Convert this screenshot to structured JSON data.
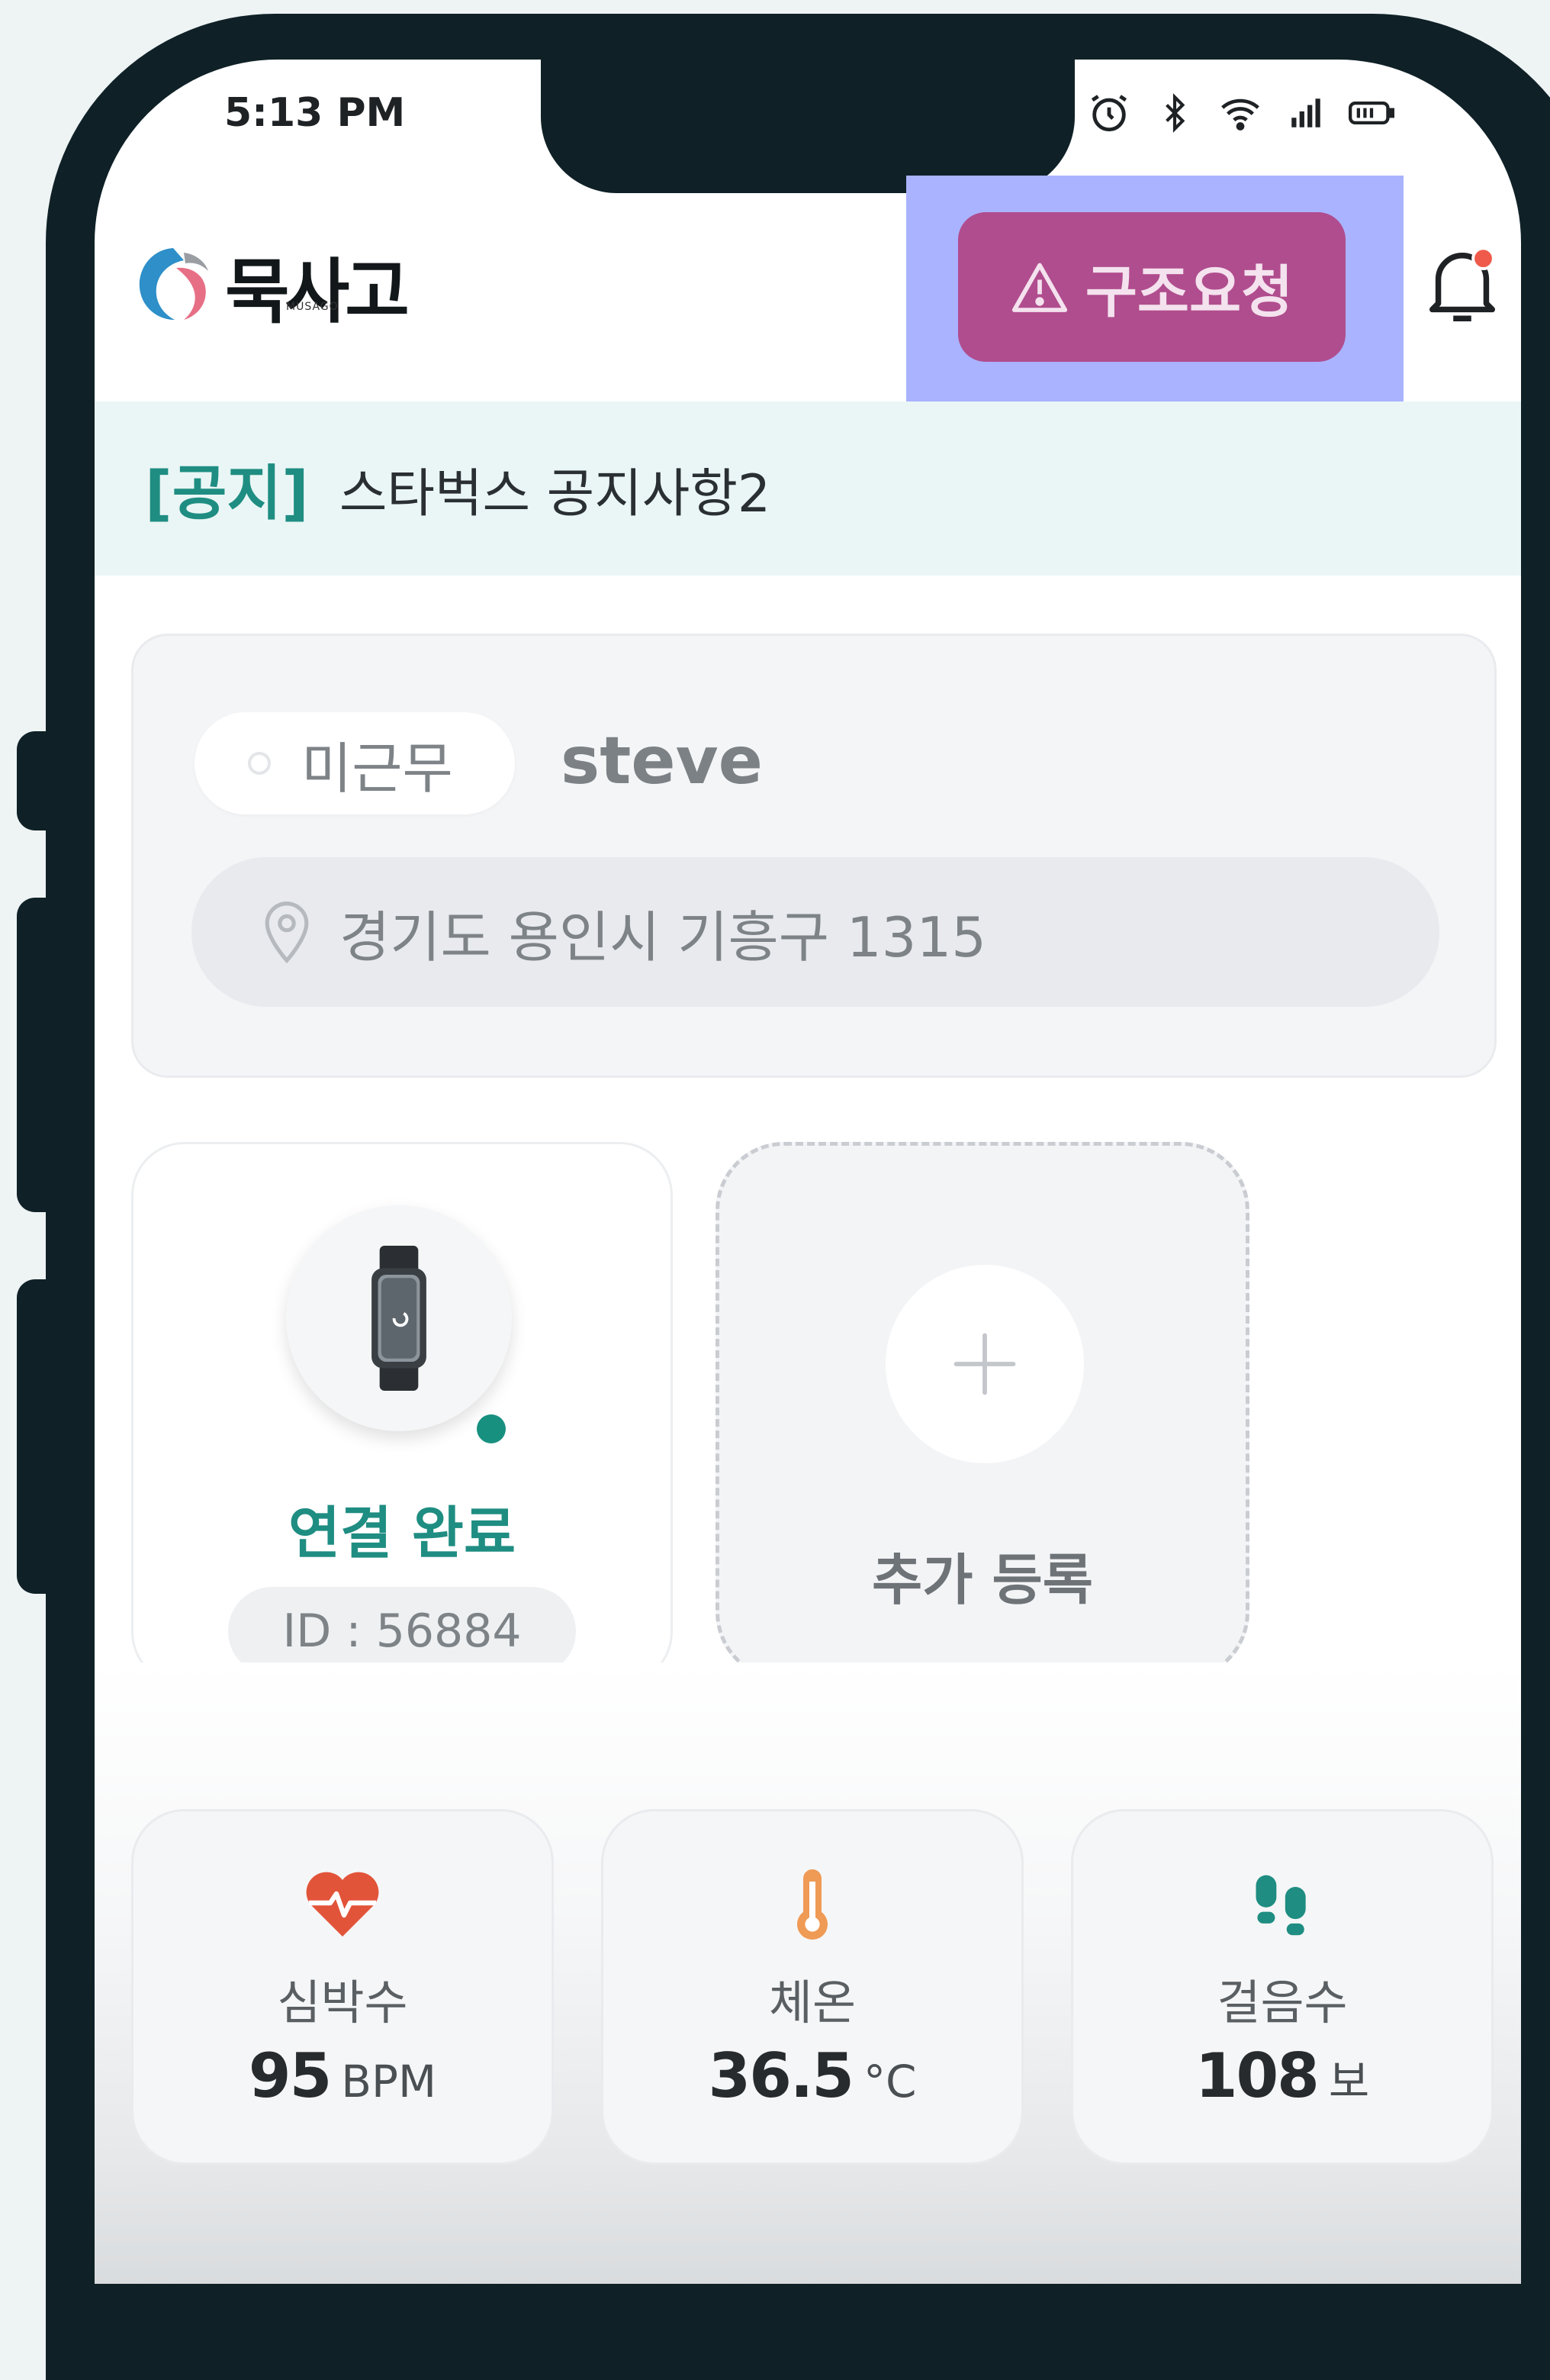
{
  "status_bar": {
    "time": "5:13 PM",
    "icons": [
      "alarm-icon",
      "bluetooth-icon",
      "wifi-icon",
      "signal-icon",
      "battery-icon"
    ]
  },
  "header": {
    "logo_text": "묵사고",
    "logo_subtext": "MUSAGO",
    "sos_button_label": "구조요청",
    "bell_has_dot": true
  },
  "notice": {
    "tag": "[공지]",
    "text": "스타벅스 공지사항2"
  },
  "user_card": {
    "work_status": "미근무",
    "name": "steve",
    "address": "경기도 용인시 기흥구 1315"
  },
  "device_card": {
    "status": "연결 완료",
    "id_text": "ID : 56884"
  },
  "add_device_card": {
    "label": "추가 등록"
  },
  "stats": [
    {
      "label": "심박수",
      "value": "95",
      "unit": "BPM",
      "icon": "heart-rate-icon"
    },
    {
      "label": "체온",
      "value": "36.5",
      "unit": "°C",
      "icon": "thermometer-icon"
    },
    {
      "label": "걸음수",
      "value": "108",
      "unit": "보",
      "icon": "footsteps-icon"
    }
  ],
  "colors": {
    "accent_teal": "#1f8d82",
    "sos_button": "#b04d8e",
    "highlight": "#aab3ff",
    "heart": "#e2543a",
    "thermometer": "#ef9a55"
  }
}
